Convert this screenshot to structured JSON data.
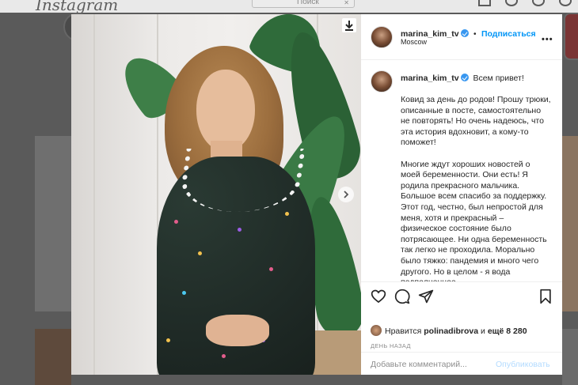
{
  "header": {
    "logo": "Instagram",
    "search_placeholder": "Поиск"
  },
  "post": {
    "username": "marina_kim_tv",
    "verified": true,
    "follow_label": "Подписаться",
    "separator": "•",
    "location": "Moscow",
    "caption_first_line": "Всем привет!",
    "caption_body": "Ковид за день до родов! Прошу трюки, описанные в посте, самостоятельно не повторять! Но очень надеюсь, что эта история вдохновит, а кому-то поможет!\n\nМногие ждут хороших новостей о моей беременности. Они есть! Я родила прекрасного мальчика. Большое всем спасибо за поддержку. Этот год, честно, был непростой для меня, хотя и прекрасный – физическое состояние было потрясающее. Ни одна беременность так легко не проходила. Морально было тяжко: пандемия и много чего другого. Но в целом - я вода подполненное",
    "likes_prefix": "Нравится",
    "likes_user": "polinadibrova",
    "likes_middle": "и",
    "likes_count": "ещё 8 280",
    "time": "ДЕНЬ НАЗАД",
    "comment_placeholder": "Добавьте комментарий...",
    "post_button": "Опубликовать"
  },
  "icons": {
    "download": "download-icon",
    "next": "chevron-right-icon",
    "more": "more-horizontal-icon",
    "like": "heart-icon",
    "comment": "comment-icon",
    "share": "paper-plane-icon",
    "save": "bookmark-icon"
  },
  "colors": {
    "accent": "#0095f6",
    "verified": "#3897f0",
    "post_disabled": "#b3dbff"
  }
}
